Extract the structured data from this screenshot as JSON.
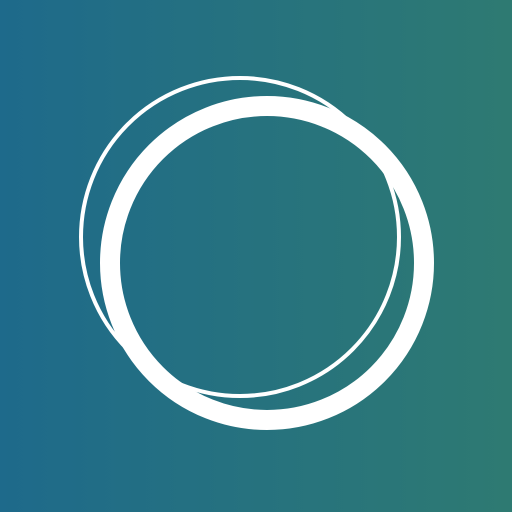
{
  "app": {
    "name": "",
    "icon": "double-ring-logo-icon"
  },
  "colors": {
    "background_left": "#1e6a8b",
    "background_right": "#2e7a72",
    "ring": "#ffffff"
  }
}
